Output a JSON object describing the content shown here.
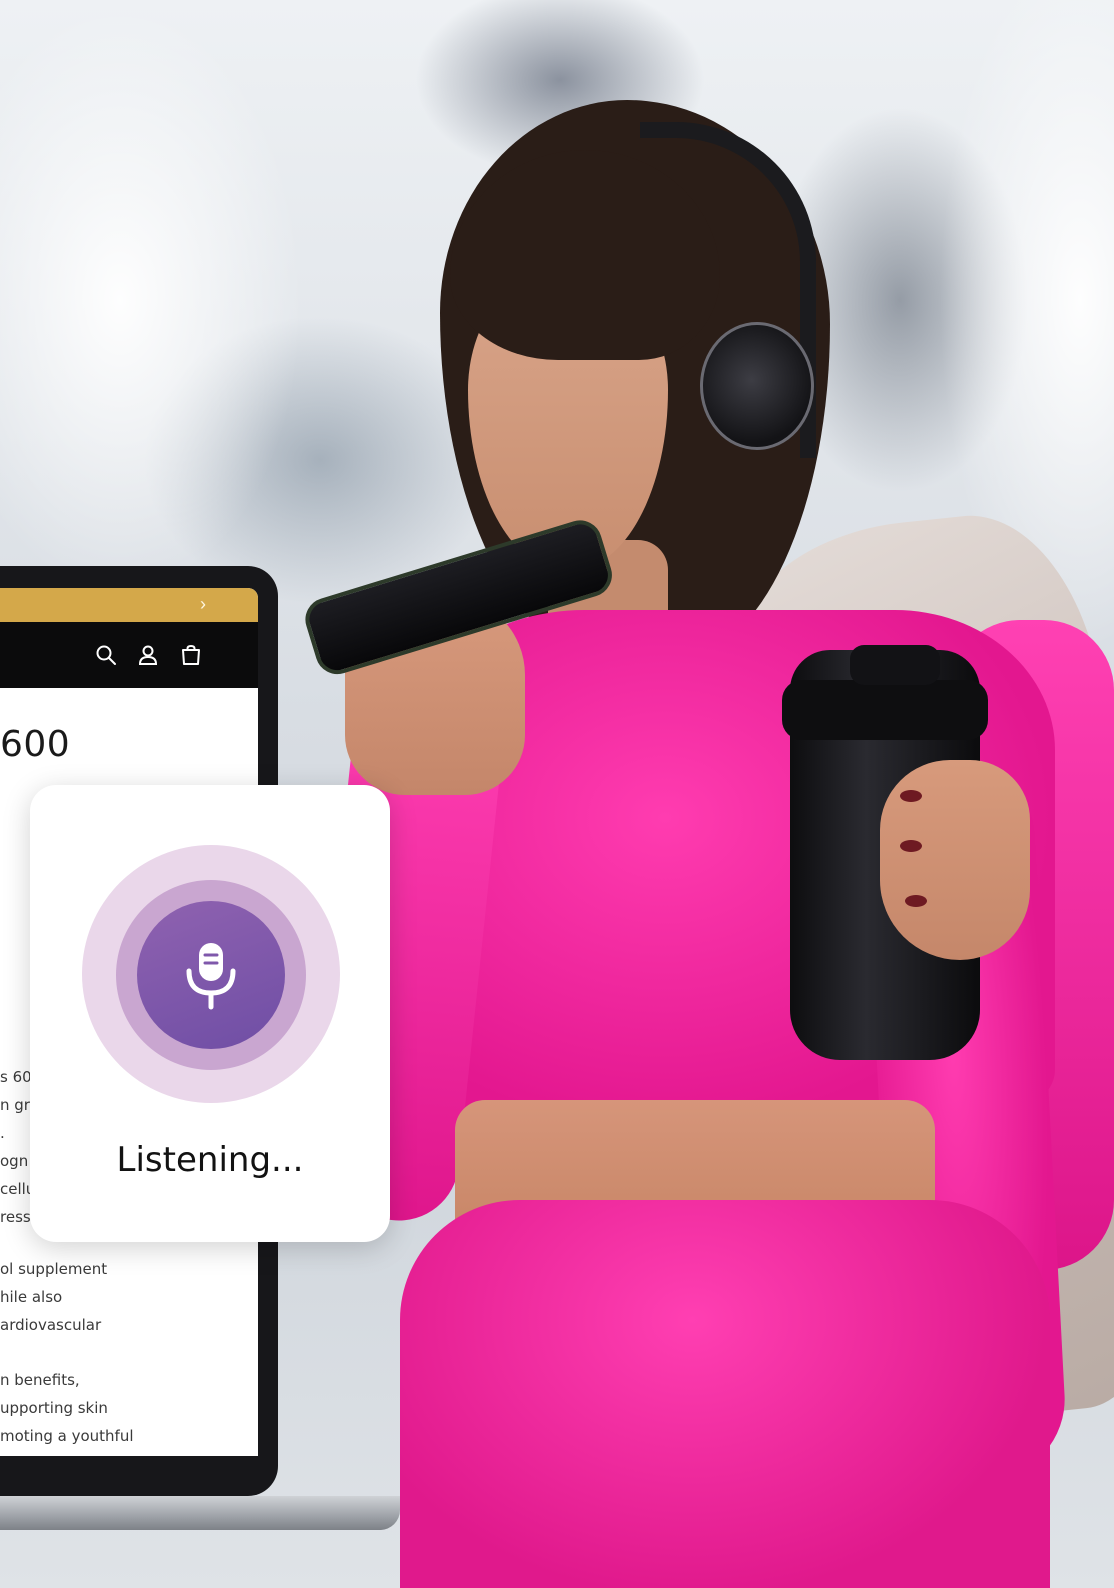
{
  "store": {
    "announcement_arrow": "›",
    "icons": [
      "search-icon",
      "account-icon",
      "cart-icon"
    ],
    "price_text": "600",
    "description_fragments": [
      "s 60",
      "n gr",
      ".",
      "ogn",
      "cellu",
      "ress,",
      "ol supplement",
      "hile also",
      "ardiovascular",
      "n benefits,",
      "upporting skin",
      "moting a youthful"
    ]
  },
  "voice_widget": {
    "status_label": "Listening...",
    "icon": "microphone-icon",
    "colors": {
      "outer_ring": "#ead7ea",
      "middle_ring": "#c9a6d0",
      "button": "#7f58ab"
    }
  },
  "colors": {
    "announcement_bar": "#d4a84a",
    "navbar": "#0b0b0c"
  }
}
